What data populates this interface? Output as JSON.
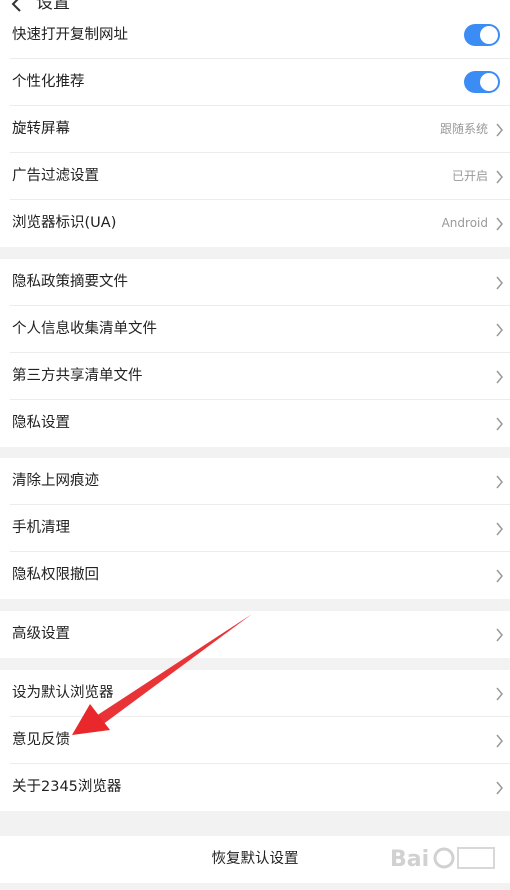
{
  "header": {
    "title": "设置"
  },
  "groups": [
    {
      "items": [
        {
          "label": "快速打开复制网址",
          "control": "toggle",
          "on": true
        },
        {
          "label": "个性化推荐",
          "control": "toggle",
          "on": true
        },
        {
          "label": "旋转屏幕",
          "value": "跟随系统"
        },
        {
          "label": "广告过滤设置",
          "value": "已开启"
        },
        {
          "label": "浏览器标识(UA)",
          "value": "Android"
        }
      ]
    },
    {
      "items": [
        {
          "label": "隐私政策摘要文件"
        },
        {
          "label": "个人信息收集清单文件"
        },
        {
          "label": "第三方共享清单文件"
        },
        {
          "label": "隐私设置"
        }
      ]
    },
    {
      "items": [
        {
          "label": "清除上网痕迹"
        },
        {
          "label": "手机清理"
        },
        {
          "label": "隐私权限撤回"
        }
      ]
    },
    {
      "items": [
        {
          "label": "高级设置"
        }
      ]
    },
    {
      "items": [
        {
          "label": "设为默认浏览器"
        },
        {
          "label": "意见反馈"
        },
        {
          "label": "关于2345浏览器"
        }
      ]
    }
  ],
  "restore": {
    "label": "恢复默认设置"
  },
  "colors": {
    "accent": "#3b8cf5",
    "annotation_arrow": "#e8282b"
  }
}
